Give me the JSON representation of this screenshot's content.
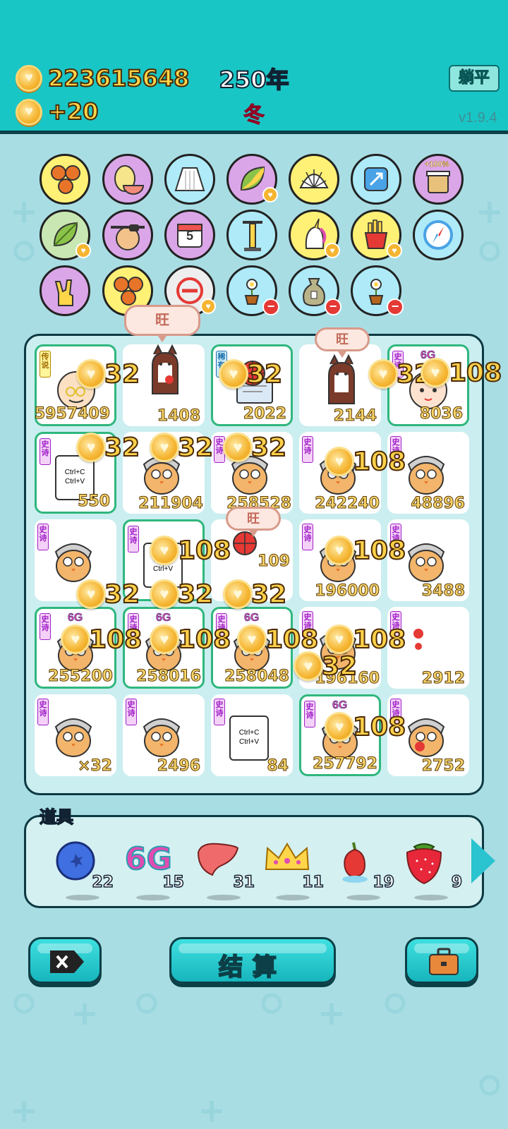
{
  "header": {
    "coins": "223615648",
    "income": "+20",
    "year": "250年",
    "season": "冬",
    "flat_button": "躺平",
    "version": "v1.9.4"
  },
  "bubbles": {
    "wang": "旺"
  },
  "grid": {
    "rows": [
      [
        "5957409",
        "1408",
        "2022",
        "2144",
        "8036"
      ],
      [
        "550",
        "211904",
        "258528",
        "242240",
        "48896"
      ],
      [
        "",
        "",
        "109",
        "196000",
        "3488"
      ],
      [
        "255200",
        "258016",
        "258048",
        "196160",
        "2912"
      ],
      [
        "×32",
        "2496",
        "84",
        "257792",
        "2752"
      ]
    ],
    "tags": {
      "legend": "传说",
      "epic": "史诗",
      "rare": "稀有"
    },
    "six_g": "6G",
    "copy_paste": "Ctrl+C Ctrl+V"
  },
  "score_popups": {
    "p32": "32",
    "p108": "108"
  },
  "items": {
    "calendar_day": "5",
    "bucket_label": "+100%"
  },
  "props": {
    "label": "道具",
    "list": [
      {
        "name": "blueberry",
        "count": "22"
      },
      {
        "name": "6G",
        "count": "15"
      },
      {
        "name": "liver",
        "count": "31"
      },
      {
        "name": "crown",
        "count": "11"
      },
      {
        "name": "chili",
        "count": "19"
      },
      {
        "name": "strawberry",
        "count": "9"
      }
    ]
  },
  "buttons": {
    "settle": "结算"
  },
  "colors": {
    "header_bg": "#19c6c6",
    "page_bg": "#a9dde4",
    "gold_text": "#ffd54a",
    "season_red": "#ff3b5c"
  }
}
